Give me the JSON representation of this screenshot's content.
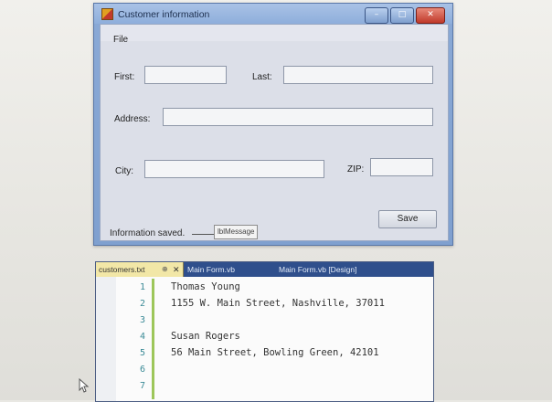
{
  "form_window": {
    "title": "Customer information",
    "menu": {
      "file": "File"
    },
    "fields": {
      "first_label": "First:",
      "last_label": "Last:",
      "address_label": "Address:",
      "city_label": "City:",
      "zip_label": "ZIP:",
      "first_value": "",
      "last_value": "",
      "address_value": "",
      "city_value": "",
      "zip_value": ""
    },
    "save_button": "Save",
    "status_text": "Information saved.",
    "message_label": "lblMessage"
  },
  "editor_window": {
    "tabs": [
      {
        "label": "customers.txt"
      },
      {
        "label": "Main Form.vb"
      },
      {
        "label": "Main Form.vb [Design]"
      }
    ],
    "line_numbers": [
      "1",
      "2",
      "3",
      "4",
      "5",
      "6",
      "7"
    ],
    "lines": [
      "Thomas Young",
      "1155 W. Main Street, Nashville, 37011",
      "",
      "Susan Rogers",
      "56 Main Street, Bowling Green, 42101",
      "",
      ""
    ]
  }
}
